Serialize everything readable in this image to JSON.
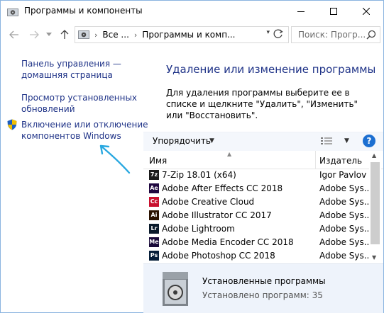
{
  "window": {
    "title": "Программы и компоненты"
  },
  "address": {
    "crumb_all": "Все ...",
    "crumb_current": "Программы и комп...",
    "search_placeholder": "Поиск: Прогр..."
  },
  "sidebar": {
    "home_line1": "Панель управления —",
    "home_line2": "домашняя страница",
    "updates_line1": "Просмотр установленных",
    "updates_line2": "обновлений",
    "features_line1": "Включение или отключение",
    "features_line2": "компонентов Windows"
  },
  "main": {
    "heading": "Удаление или изменение программы",
    "description": "Для удаления программы выберите ее в списке и щелкните \"Удалить\", \"Изменить\" или \"Восстановить\"."
  },
  "toolbar": {
    "organize_label": "Упорядочить"
  },
  "table": {
    "col_name": "Имя",
    "col_publisher": "Издатель",
    "rows": [
      {
        "name": "7-Zip 18.01 (x64)",
        "publisher": "Igor Pavlov",
        "icon": "7z",
        "color": "#1a1a1a"
      },
      {
        "name": "Adobe After Effects CC 2018",
        "publisher": "Adobe Sys...",
        "icon": "Ae",
        "color": "#1f0740"
      },
      {
        "name": "Adobe Creative Cloud",
        "publisher": "Adobe Sys...",
        "icon": "Cc",
        "color": "#c8102e"
      },
      {
        "name": "Adobe Illustrator CC 2017",
        "publisher": "Adobe Sys...",
        "icon": "Ai",
        "color": "#2b1200"
      },
      {
        "name": "Adobe Lightroom",
        "publisher": "Adobe Sys...",
        "icon": "Lr",
        "color": "#0a1a2b"
      },
      {
        "name": "Adobe Media Encoder CC 2018",
        "publisher": "Adobe Sys...",
        "icon": "Me",
        "color": "#1a0b3a"
      },
      {
        "name": "Adobe Photoshop CC 2018",
        "publisher": "Adobe Sys...",
        "icon": "Ps",
        "color": "#061e3a"
      }
    ]
  },
  "details": {
    "title": "Установленные программы",
    "count_text": "Установлено программ: 35"
  },
  "colors": {
    "link": "#1e3287",
    "accent_arrow": "#29a8e0"
  }
}
